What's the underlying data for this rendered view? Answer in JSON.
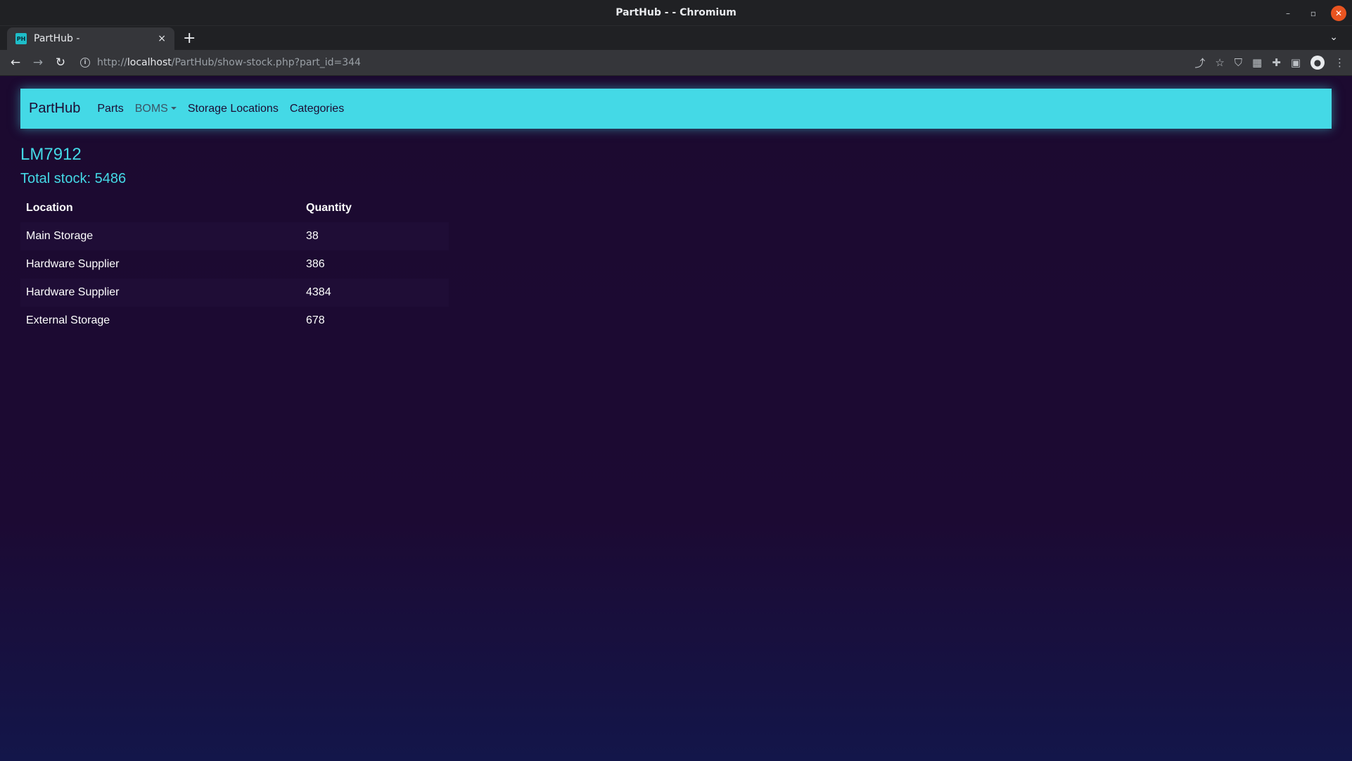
{
  "window": {
    "title": "PartHub - - Chromium"
  },
  "tab": {
    "favicon_text": "PH",
    "title": "PartHub -",
    "close": "×",
    "new_tab": "+"
  },
  "toolbar": {
    "url_scheme": "http://",
    "url_host": "localhost",
    "url_path": "/PartHub/show-stock.php?part_id=344"
  },
  "navbar": {
    "brand": "PartHub",
    "links": [
      "Parts",
      "BOMS",
      "Storage Locations",
      "Categories"
    ]
  },
  "page": {
    "part_name": "LM7912",
    "total_stock": "Total stock: 5486"
  },
  "table": {
    "headers": [
      "Location",
      "Quantity"
    ],
    "rows": [
      [
        "Main Storage",
        "38"
      ],
      [
        "Hardware Supplier",
        "386"
      ],
      [
        "Hardware Supplier",
        "4384"
      ],
      [
        "External Storage",
        "678"
      ]
    ]
  },
  "colors": {
    "accent": "#44d9e6",
    "background": "#1c0a30",
    "navbar_text": "#1d0c33"
  }
}
